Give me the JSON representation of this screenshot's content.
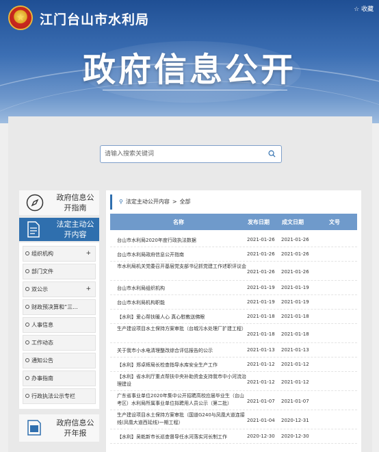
{
  "header": {
    "site_title": "江门台山市水利局",
    "favorite_label": "☆ 收藏",
    "hero_title": "政府信息公开"
  },
  "search": {
    "placeholder": "请输入搜索关键词"
  },
  "sidebar": {
    "guide_label": "政府信息公开指南",
    "active_label": "法定主动公开内容",
    "items": [
      {
        "label": "组织机构",
        "has_plus": true
      },
      {
        "label": "部门文件",
        "has_plus": false
      },
      {
        "label": "双公示",
        "has_plus": true
      },
      {
        "label": "财政预决算和“三...",
        "has_plus": false
      },
      {
        "label": "人事信息",
        "has_plus": false
      },
      {
        "label": "工作动态",
        "has_plus": false
      },
      {
        "label": "通知公告",
        "has_plus": false
      },
      {
        "label": "办事指南",
        "has_plus": false
      },
      {
        "label": "行政执法公示专栏",
        "has_plus": false
      }
    ],
    "annual_label": "政府信息公开年报"
  },
  "breadcrumb": {
    "section": "法定主动公开内容",
    "separator": ">",
    "current": "全部"
  },
  "table": {
    "headers": {
      "name": "名称",
      "published": "发布日期",
      "completed": "成文日期",
      "doc_no": "文号"
    },
    "rows": [
      {
        "name": "台山市水利局2020年度行政执法数据",
        "published": "2021-01-26",
        "completed": "2021-01-26"
      },
      {
        "name": "台山市水利局政府信息公开指南",
        "published": "2021-01-26",
        "completed": "2021-01-26"
      },
      {
        "name": "市水利局机关党委召开基层党支部书记抓党建工作述职评议会",
        "published": "2021-01-26",
        "completed": "2021-01-26"
      },
      {
        "name": "台山市水利局组织机构",
        "published": "2021-01-19",
        "completed": "2021-01-19"
      },
      {
        "name": "台山市水利局机构职能",
        "published": "2021-01-19",
        "completed": "2021-01-19"
      },
      {
        "name": "【水利】爱心帮扶暖人心 真心慰教送佛眼",
        "published": "2021-01-18",
        "completed": "2021-01-18"
      },
      {
        "name": "生产建设项目水土保持方案审批（台城污水处理厂扩建工程）",
        "published": "2021-01-18",
        "completed": "2021-01-18"
      },
      {
        "name": "关于我市小水电清理整改综合评估报告的公示",
        "published": "2021-01-13",
        "completed": "2021-01-13"
      },
      {
        "name": "【水利】郑卓辉局长检查指导水库安全生产工作",
        "published": "2021-01-12",
        "completed": "2021-01-12"
      },
      {
        "name": "【水利】省水利厅重点帮扶中央补助资金支持我市中小河流治理建设",
        "published": "2021-01-12",
        "completed": "2021-01-12"
      },
      {
        "name": "广东省事业单位2020年集中公开招聘高校应届毕业生（台山考区）水利局所属事业单位拟聘用人员公示（第二批）",
        "published": "2021-01-07",
        "completed": "2021-01-07"
      },
      {
        "name": "生产建设项目水土保持方案审批（国道G240与凤凰大道连接线(凤凰大道西延线)一期工程）",
        "published": "2021-01-04",
        "completed": "2020-12-31"
      },
      {
        "name": "【水利】吴乾新市长巡查督导任水河落实河长制工作",
        "published": "2020-12-30",
        "completed": "2020-12-30"
      }
    ]
  }
}
